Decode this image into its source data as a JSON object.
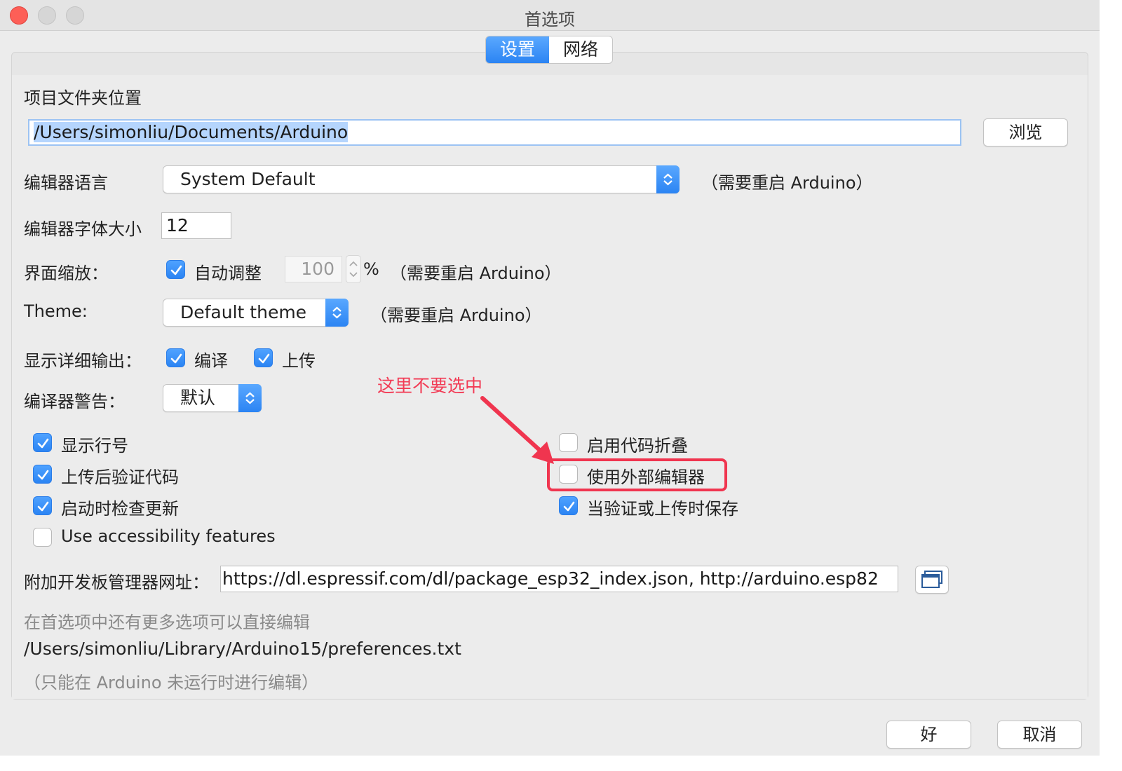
{
  "window": {
    "title": "首选项"
  },
  "tabs": [
    {
      "label": "设置",
      "active": true
    },
    {
      "label": "网络",
      "active": false
    }
  ],
  "sketchbook": {
    "label": "项目文件夹位置",
    "value": "/Users/simonliu/Documents/Arduino",
    "browse_label": "浏览"
  },
  "editor_language": {
    "label": "编辑器语言",
    "selected": "System Default",
    "note": "（需要重启 Arduino）"
  },
  "editor_font_size": {
    "label": "编辑器字体大小",
    "value": "12"
  },
  "interface_scale": {
    "label": "界面缩放：",
    "auto_label": "自动调整",
    "auto_checked": true,
    "value": "100",
    "percent": "%",
    "note": "（需要重启 Arduino）"
  },
  "theme": {
    "label": "Theme:",
    "selected": "Default theme",
    "note": "（需要重启 Arduino）"
  },
  "verbose": {
    "label": "显示详细输出：",
    "compile_label": "编译",
    "compile_checked": true,
    "upload_label": "上传",
    "upload_checked": true
  },
  "compiler_warnings": {
    "label": "编译器警告：",
    "selected": "默认"
  },
  "options_left": [
    {
      "label": "显示行号",
      "checked": true
    },
    {
      "label": "上传后验证代码",
      "checked": true
    },
    {
      "label": "启动时检查更新",
      "checked": true
    },
    {
      "label": "Use accessibility features",
      "checked": false
    }
  ],
  "options_right": [
    {
      "label": "启用代码折叠",
      "checked": false
    },
    {
      "label": "使用外部编辑器",
      "checked": false
    },
    {
      "label": "当验证或上传时保存",
      "checked": true
    }
  ],
  "board_urls": {
    "label": "附加开发板管理器网址：",
    "value": "https://dl.espressif.com/dl/package_esp32_index.json, http://arduino.esp82"
  },
  "more_prefs": {
    "hint": "在首选项中还有更多选项可以直接编辑",
    "path": "/Users/simonliu/Library/Arduino15/preferences.txt",
    "note": "（只能在 Arduino 未运行时进行编辑）"
  },
  "footer": {
    "ok_label": "好",
    "cancel_label": "取消"
  },
  "annotation": {
    "text": "这里不要选中",
    "color": "#f0354f"
  }
}
